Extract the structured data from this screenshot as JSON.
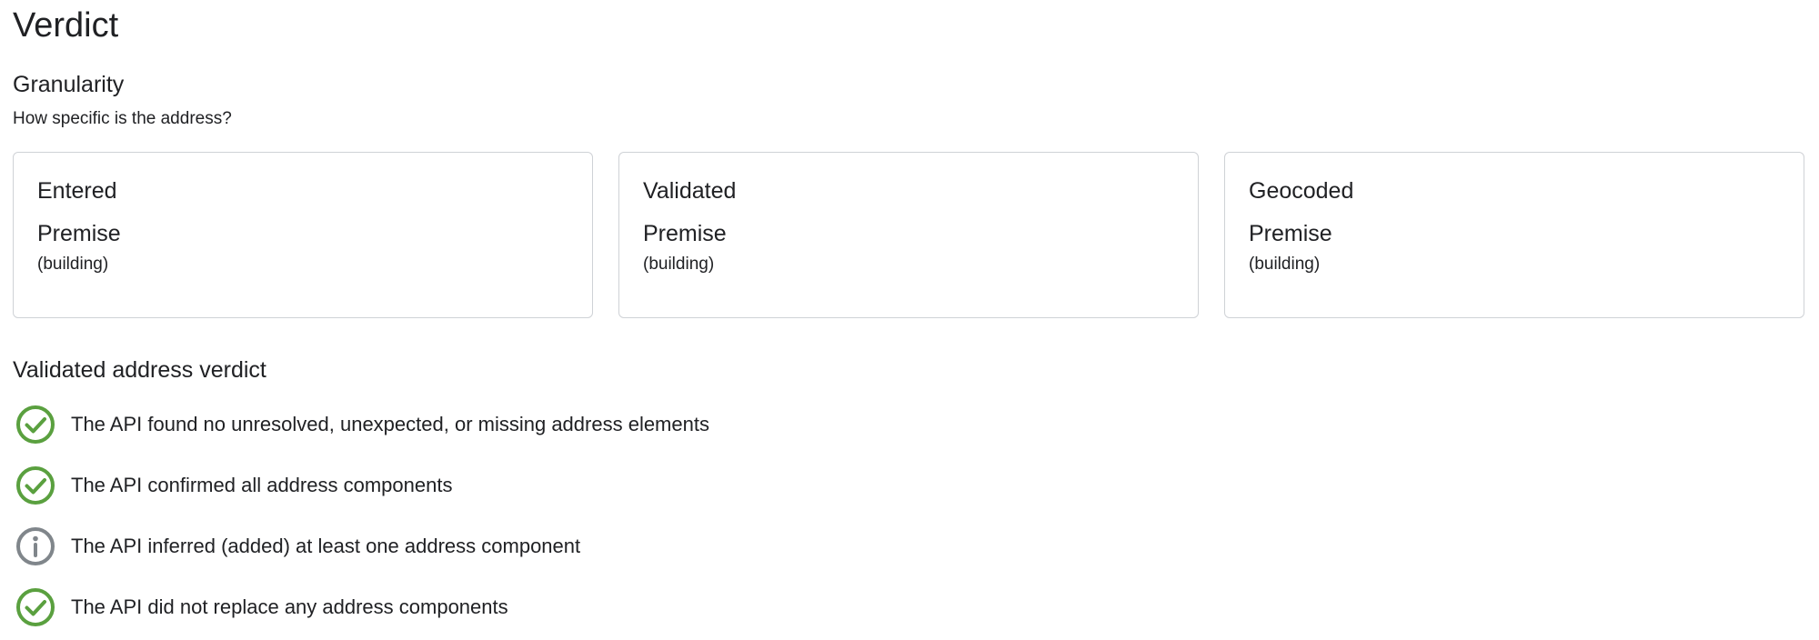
{
  "page": {
    "title": "Verdict"
  },
  "granularity": {
    "title": "Granularity",
    "subtitle": "How specific is the address?",
    "cards": [
      {
        "heading": "Entered",
        "value": "Premise",
        "detail": "(building)"
      },
      {
        "heading": "Validated",
        "value": "Premise",
        "detail": "(building)"
      },
      {
        "heading": "Geocoded",
        "value": "Premise",
        "detail": "(building)"
      }
    ]
  },
  "validated_verdict": {
    "title": "Validated address verdict",
    "items": [
      {
        "icon": "check-circle-icon",
        "status": "success",
        "text": "The API found no unresolved, unexpected, or missing address elements"
      },
      {
        "icon": "check-circle-icon",
        "status": "success",
        "text": "The API confirmed all address components"
      },
      {
        "icon": "info-circle-icon",
        "status": "info",
        "text": "The API inferred (added) at least one address component"
      },
      {
        "icon": "check-circle-icon",
        "status": "success",
        "text": "The API did not replace any address components"
      }
    ]
  },
  "colors": {
    "success": "#5aa03f",
    "info": "#80868b",
    "card_border": "#cfd2d6",
    "text": "#202124"
  }
}
